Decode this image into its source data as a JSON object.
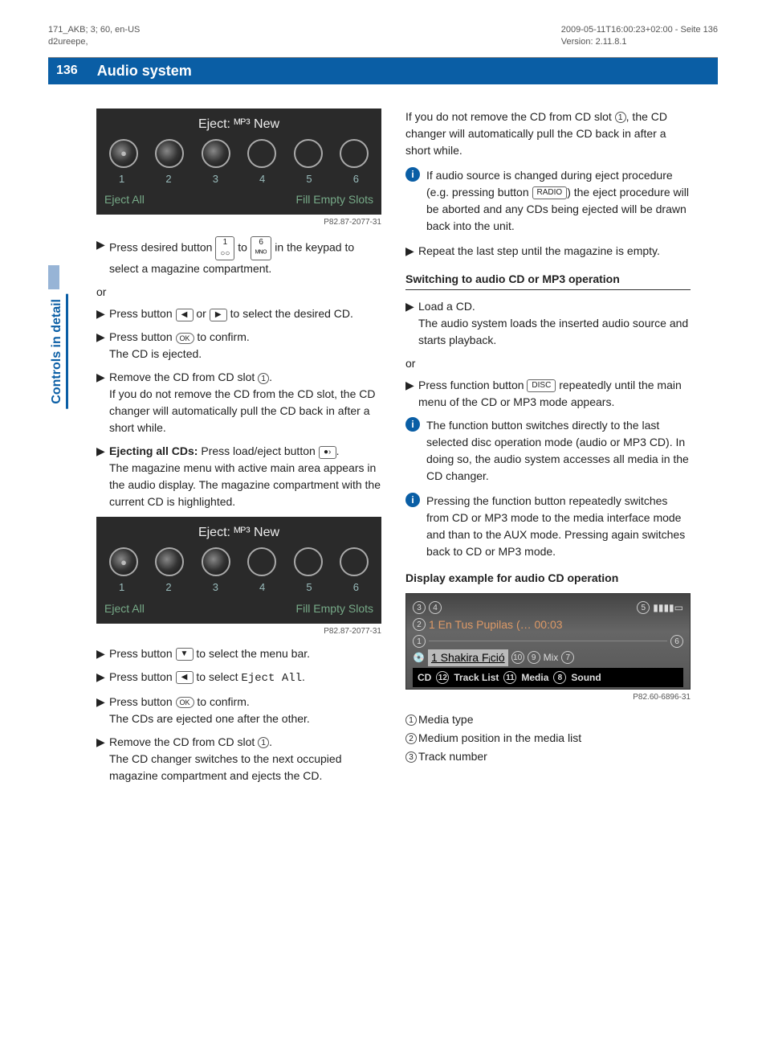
{
  "meta": {
    "left1": "171_AKB; 3; 60, en-US",
    "left2": "d2ureepe,",
    "right1": "2009-05-11T16:00:23+02:00 - Seite 136",
    "right2": "Version: 2.11.8.1"
  },
  "pageNumber": "136",
  "pageTitle": "Audio system",
  "sideTab": "Controls in detail",
  "fig1": {
    "title": "Eject: ᴹᴾ³ New",
    "nums": [
      "1",
      "2",
      "3",
      "4",
      "5",
      "6"
    ],
    "left": "Eject All",
    "right": "Fill Empty Slots",
    "code": "P82.87-2077-31"
  },
  "left": {
    "li1a": "Press desired button ",
    "li1b": " to ",
    "li1c": " in the keypad to select a magazine compartment.",
    "key1": "1",
    "key6": "6",
    "or": "or",
    "li2a": "Press button ",
    "li2b": " or ",
    "li2c": " to select the desired CD.",
    "li3a": "Press button ",
    "li3b": " to confirm.",
    "li3c": "The CD is ejected.",
    "ok": "OK",
    "li4a": "Remove the CD from CD slot ",
    "li4b": ".",
    "li4c": "If you do not remove the CD from the CD slot, the CD changer will automatically pull the CD back in after a short while.",
    "li5a": "Ejecting all CDs:",
    "li5b": " Press load/eject button ",
    "li5c": ".",
    "li5d": "The magazine menu with active main area appears in the audio display. The magazine compartment with the current CD is highlighted.",
    "ejectIcon": "●›",
    "li6a": "Press button ",
    "li6b": " to select the menu bar.",
    "li7a": "Press button ",
    "li7b": " to select ",
    "li7c": "Eject All",
    "li7d": ".",
    "li8a": "Press button ",
    "li8b": " to confirm.",
    "li8c": "The CDs are ejected one after the other.",
    "li9a": "Remove the CD from CD slot ",
    "li9b": ".",
    "li9c": "The CD changer switches to the next occupied magazine compartment and ejects the CD.",
    "c1": "1"
  },
  "right": {
    "p1a": "If you do not remove the CD from CD slot ",
    "p1b": ", the CD changer will automatically pull the CD back in after a short while.",
    "info1a": "If audio source is changed during eject procedure (e.g. pressing button ",
    "info1b": ") the eject procedure will be aborted and any CDs being ejected will be drawn back into the unit.",
    "radio": "RADIO",
    "li1": "Repeat the last step until the magazine is empty.",
    "h3": "Switching to audio CD or MP3 operation",
    "li2a": "Load a CD.",
    "li2b": "The audio system loads the inserted audio source and starts playback.",
    "or": "or",
    "li3a": "Press function button ",
    "li3b": " repeatedly until the main menu of the CD or MP3 mode appears.",
    "disc": "DISC",
    "info2": "The function button switches directly to the last selected disc operation mode (audio or MP3 CD). In doing so, the audio system accesses all media in the CD changer.",
    "info3": "Pressing the function button repeatedly switches from CD or MP3 mode to the media interface mode and than to the AUX mode. Pressing again switches back to CD or MP3 mode.",
    "h4": "Display example for audio CD operation",
    "fig2": {
      "trackLine": "1 En Tus Pupilas (…  00:03",
      "artistLine": "1  Shakira  Fᵢció",
      "menu": [
        "CD",
        "Track List",
        "Media",
        "Sound"
      ],
      "menuNums": [
        "12",
        "11",
        "8"
      ],
      "topNums": [
        "3",
        "4",
        "5"
      ],
      "ln2": "2",
      "ln1": "1",
      "ln6": "6",
      "ln7": "7",
      "ln9": "9",
      "ln10": "10",
      "mix": "Mix",
      "code": "P82.60-6896-31"
    },
    "legend": {
      "l1n": "1",
      "l1": "Media type",
      "l2n": "2",
      "l2": "Medium position in the media list",
      "l3n": "3",
      "l3": "Track number"
    },
    "c1": "1"
  }
}
